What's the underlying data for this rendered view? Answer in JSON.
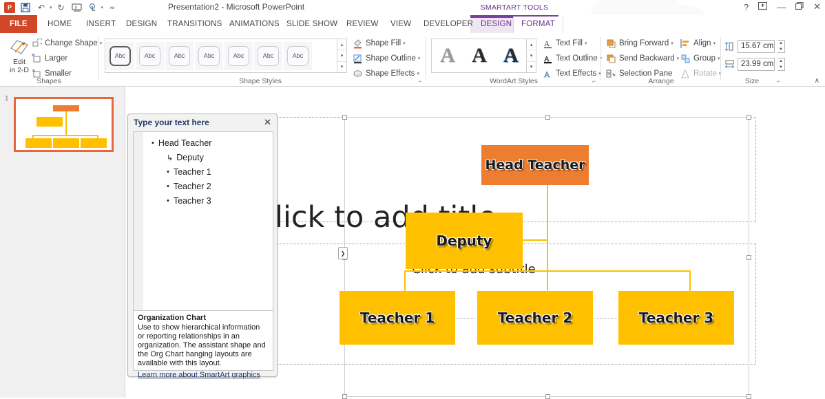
{
  "window": {
    "title": "Presentation2 - Microsoft PowerPoint",
    "quick_access": [
      {
        "name": "powerpoint-logo",
        "glyph": "P"
      },
      {
        "name": "save-icon",
        "glyph": "⬜"
      },
      {
        "name": "undo-icon",
        "glyph": "↶"
      },
      {
        "name": "redo-icon",
        "glyph": "↻"
      },
      {
        "name": "start-presentation-icon",
        "glyph": "▭"
      },
      {
        "name": "touch-mode-icon",
        "glyph": "☝"
      },
      {
        "name": "customize-qat-icon",
        "glyph": "≡"
      }
    ],
    "controls": [
      {
        "name": "help-button",
        "glyph": "?"
      },
      {
        "name": "ribbon-display-options-button",
        "glyph": "⬒"
      },
      {
        "name": "minimize-button",
        "glyph": "—"
      },
      {
        "name": "restore-button",
        "glyph": "❐"
      },
      {
        "name": "close-button",
        "glyph": "✕"
      }
    ]
  },
  "tabs": {
    "file": "FILE",
    "items": [
      "HOME",
      "INSERT",
      "DESIGN",
      "TRANSITIONS",
      "ANIMATIONS",
      "SLIDE SHOW",
      "REVIEW",
      "VIEW",
      "DEVELOPER"
    ],
    "contextual_label": "SMARTART TOOLS",
    "contextual_items": [
      "DESIGN",
      "FORMAT"
    ],
    "active": "FORMAT"
  },
  "ribbon": {
    "groups": {
      "shapes": {
        "label": "Shapes",
        "edit_2d": "Edit\nin 2-D",
        "edit_2d_line1": "Edit",
        "edit_2d_line2": "in 2-D",
        "change_shape": "Change Shape",
        "larger": "Larger",
        "smaller": "Smaller"
      },
      "shape_styles": {
        "label": "Shape Styles",
        "thumb_label": "Abc",
        "thumbs": [
          "Abc",
          "Abc",
          "Abc",
          "Abc",
          "Abc",
          "Abc",
          "Abc"
        ],
        "shape_fill": "Shape Fill",
        "shape_outline": "Shape Outline",
        "shape_effects": "Shape Effects"
      },
      "wordart_styles": {
        "label": "WordArt Styles",
        "thumbs": [
          "A",
          "A",
          "A"
        ],
        "text_fill": "Text Fill",
        "text_outline": "Text Outline",
        "text_effects": "Text Effects"
      },
      "arrange": {
        "label": "Arrange",
        "bring_forward": "Bring Forward",
        "send_backward": "Send Backward",
        "selection_pane": "Selection Pane",
        "align": "Align",
        "group": "Group",
        "rotate": "Rotate"
      },
      "size": {
        "label": "Size",
        "height_value": "15.67 cm",
        "width_value": "23.99 cm"
      }
    },
    "collapse_glyph": "∧"
  },
  "slides_panel": {
    "slide_number": "1"
  },
  "text_pane": {
    "title": "Type your text here",
    "close_glyph": "✕",
    "items": [
      {
        "label": "Head Teacher",
        "level": 0,
        "marker": "•"
      },
      {
        "label": "Deputy",
        "level": 1,
        "marker": "↳"
      },
      {
        "label": "Teacher 1",
        "level": 1,
        "marker": "•"
      },
      {
        "label": "Teacher 2",
        "level": 1,
        "marker": "•"
      },
      {
        "label": "Teacher 3",
        "level": 1,
        "marker": "•"
      }
    ],
    "description": {
      "heading": "Organization Chart",
      "body": "Use to show hierarchical information or reporting relationships in an organization. The assistant shape and the Org Chart hanging layouts are available with this layout.",
      "link": "Learn more about SmartArt graphics"
    }
  },
  "slide": {
    "title_placeholder": "Click to add title",
    "subtitle_placeholder": "Click to add subtitle",
    "smartart": {
      "type": "organization-chart",
      "toggle_glyph": "❯",
      "nodes": [
        {
          "id": "head",
          "label": "Head Teacher",
          "color": "#ED7D31",
          "role": "manager"
        },
        {
          "id": "deputy",
          "label": "Deputy",
          "color": "#FFC000",
          "role": "assistant"
        },
        {
          "id": "t1",
          "label": "Teacher 1",
          "color": "#FFC000",
          "role": "subordinate"
        },
        {
          "id": "t2",
          "label": "Teacher 2",
          "color": "#FFC000",
          "role": "subordinate"
        },
        {
          "id": "t3",
          "label": "Teacher 3",
          "color": "#FFC000",
          "role": "subordinate"
        }
      ],
      "connector_color": "#FFC000"
    }
  },
  "colors": {
    "accent_orange": "#ED7D31",
    "accent_yellow": "#FFC000",
    "file_tab": "#D24726",
    "contextual_purple": "#68308F",
    "selection_orange": "#E8663C"
  }
}
